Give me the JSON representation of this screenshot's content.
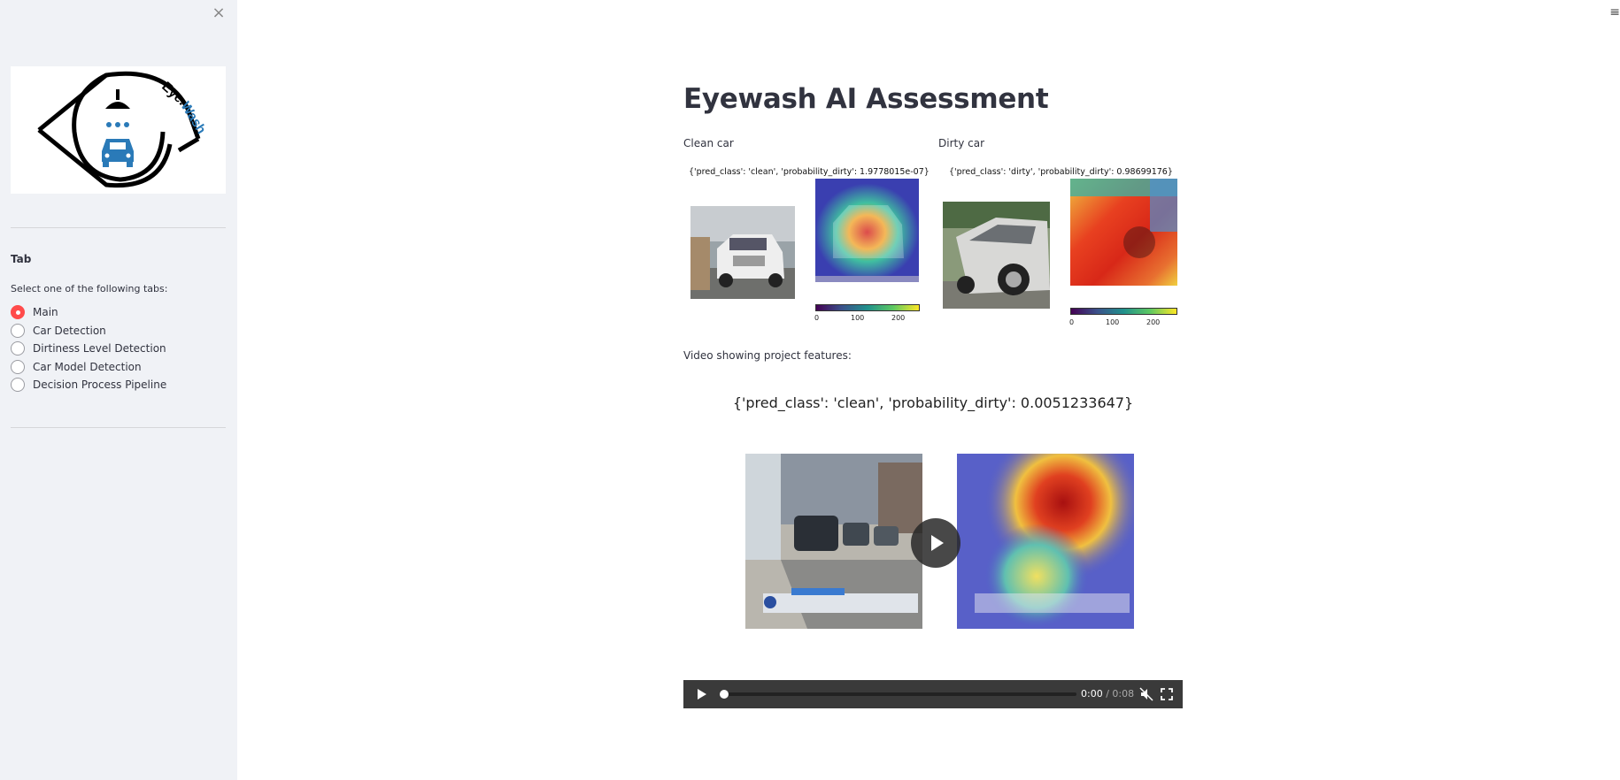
{
  "sidebar": {
    "close_label": "×",
    "logo": {
      "text_eye": "Eye.",
      "text_wash": "Wash"
    },
    "tab_heading": "Tab",
    "instructions": "Select one of the following tabs:",
    "options": [
      {
        "label": "Main",
        "selected": true
      },
      {
        "label": "Car Detection",
        "selected": false
      },
      {
        "label": "Dirtiness Level Detection",
        "selected": false
      },
      {
        "label": "Car Model Detection",
        "selected": false
      },
      {
        "label": "Decision Process Pipeline",
        "selected": false
      }
    ]
  },
  "header": {
    "menu_icon": "≡"
  },
  "main": {
    "title": "Eyewash AI Assessment",
    "clean": {
      "label": "Clean car",
      "prediction": "{'pred_class': 'clean', 'probability_dirty': 1.9778015e-07}",
      "colorbar_ticks": [
        "0",
        "100",
        "200"
      ]
    },
    "dirty": {
      "label": "Dirty car",
      "prediction": "{'pred_class': 'dirty', 'probability_dirty': 0.98699176}",
      "colorbar_ticks": [
        "0",
        "100",
        "200"
      ]
    },
    "video": {
      "label": "Video showing project features:",
      "prediction": "{'pred_class': 'clean', 'probability_dirty': 0.0051233647}",
      "current_time": "0:00",
      "duration": "/ 0:08",
      "progress": 0.0
    }
  },
  "colors": {
    "accent": "#ff4b4b",
    "sidebar_bg": "#f0f2f6",
    "logo_blue": "#2a7ab8",
    "text": "#31333f"
  }
}
